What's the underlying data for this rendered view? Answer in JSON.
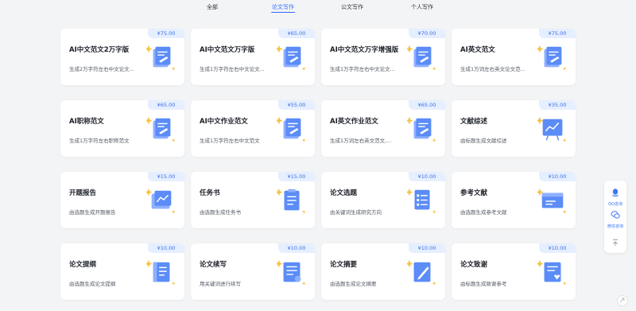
{
  "tabs": [
    {
      "label": "全部",
      "active": false
    },
    {
      "label": "论文写作",
      "active": true
    },
    {
      "label": "公文写作",
      "active": false
    },
    {
      "label": "个人写作",
      "active": false
    }
  ],
  "cards": [
    {
      "title": "AI中文范文2万字版",
      "desc": "生成2万字符左右中文论文...",
      "price": "¥75.00",
      "icon": "document-edit-icon"
    },
    {
      "title": "AI中文范文万字版",
      "desc": "生成1万字符左右中文论文...",
      "price": "¥65.00",
      "icon": "document-edit-icon"
    },
    {
      "title": "AI中文范文万字增强版",
      "desc": "生成1万字符左右中文论文...",
      "price": "¥70.00",
      "icon": "document-edit-icon"
    },
    {
      "title": "AI英文范文",
      "desc": "生成1万词左右英文论文范...",
      "price": "¥75.00",
      "icon": "document-edit-icon"
    },
    {
      "title": "AI职称范文",
      "desc": "生成1万字符左右职称范文",
      "price": "¥65.00",
      "icon": "document-edit-icon"
    },
    {
      "title": "AI中文作业范文",
      "desc": "生成1万字符左右中文范文",
      "price": "¥55.00",
      "icon": "document-edit-icon"
    },
    {
      "title": "AI英文作业范文",
      "desc": "生成1万词左右英文范文,...",
      "price": "¥65.00",
      "icon": "document-edit-icon"
    },
    {
      "title": "文献综述",
      "desc": "由标题生成文献综述",
      "price": "¥35.00",
      "icon": "chart-board-icon"
    },
    {
      "title": "开题报告",
      "desc": "由选题生成开题报告",
      "price": "¥15.00",
      "icon": "report-chart-icon"
    },
    {
      "title": "任务书",
      "desc": "由选题生成任务书",
      "price": "¥15.00",
      "icon": "task-book-icon"
    },
    {
      "title": "论文选题",
      "desc": "由关键词生成研究方向",
      "price": "¥10.00",
      "icon": "list-doc-icon"
    },
    {
      "title": "参考文献",
      "desc": "由选题生成参考文献",
      "price": "¥10.00",
      "icon": "card-doc-icon"
    },
    {
      "title": "论文提纲",
      "desc": "由选题生成论文提纲",
      "price": "¥10.00",
      "icon": "outline-doc-icon"
    },
    {
      "title": "论文续写",
      "desc": "用关键词进行续写",
      "price": "¥10.00",
      "icon": "continue-doc-icon"
    },
    {
      "title": "论文摘要",
      "desc": "由选题生成论文摘要",
      "price": "¥10.00",
      "icon": "pen-doc-icon"
    },
    {
      "title": "论文致谢",
      "desc": "由标题生成致谢参考",
      "price": "¥10.00",
      "icon": "thanks-doc-icon"
    }
  ],
  "side": {
    "qq_label": "QQ咨询",
    "wechat_label": "微信咨询",
    "top_label": "TOP"
  },
  "colors": {
    "accent": "#2f6bff",
    "price_bg": "#e6efff",
    "icon_blue": "#5b8cf7",
    "sparkle": "#f6c343"
  }
}
